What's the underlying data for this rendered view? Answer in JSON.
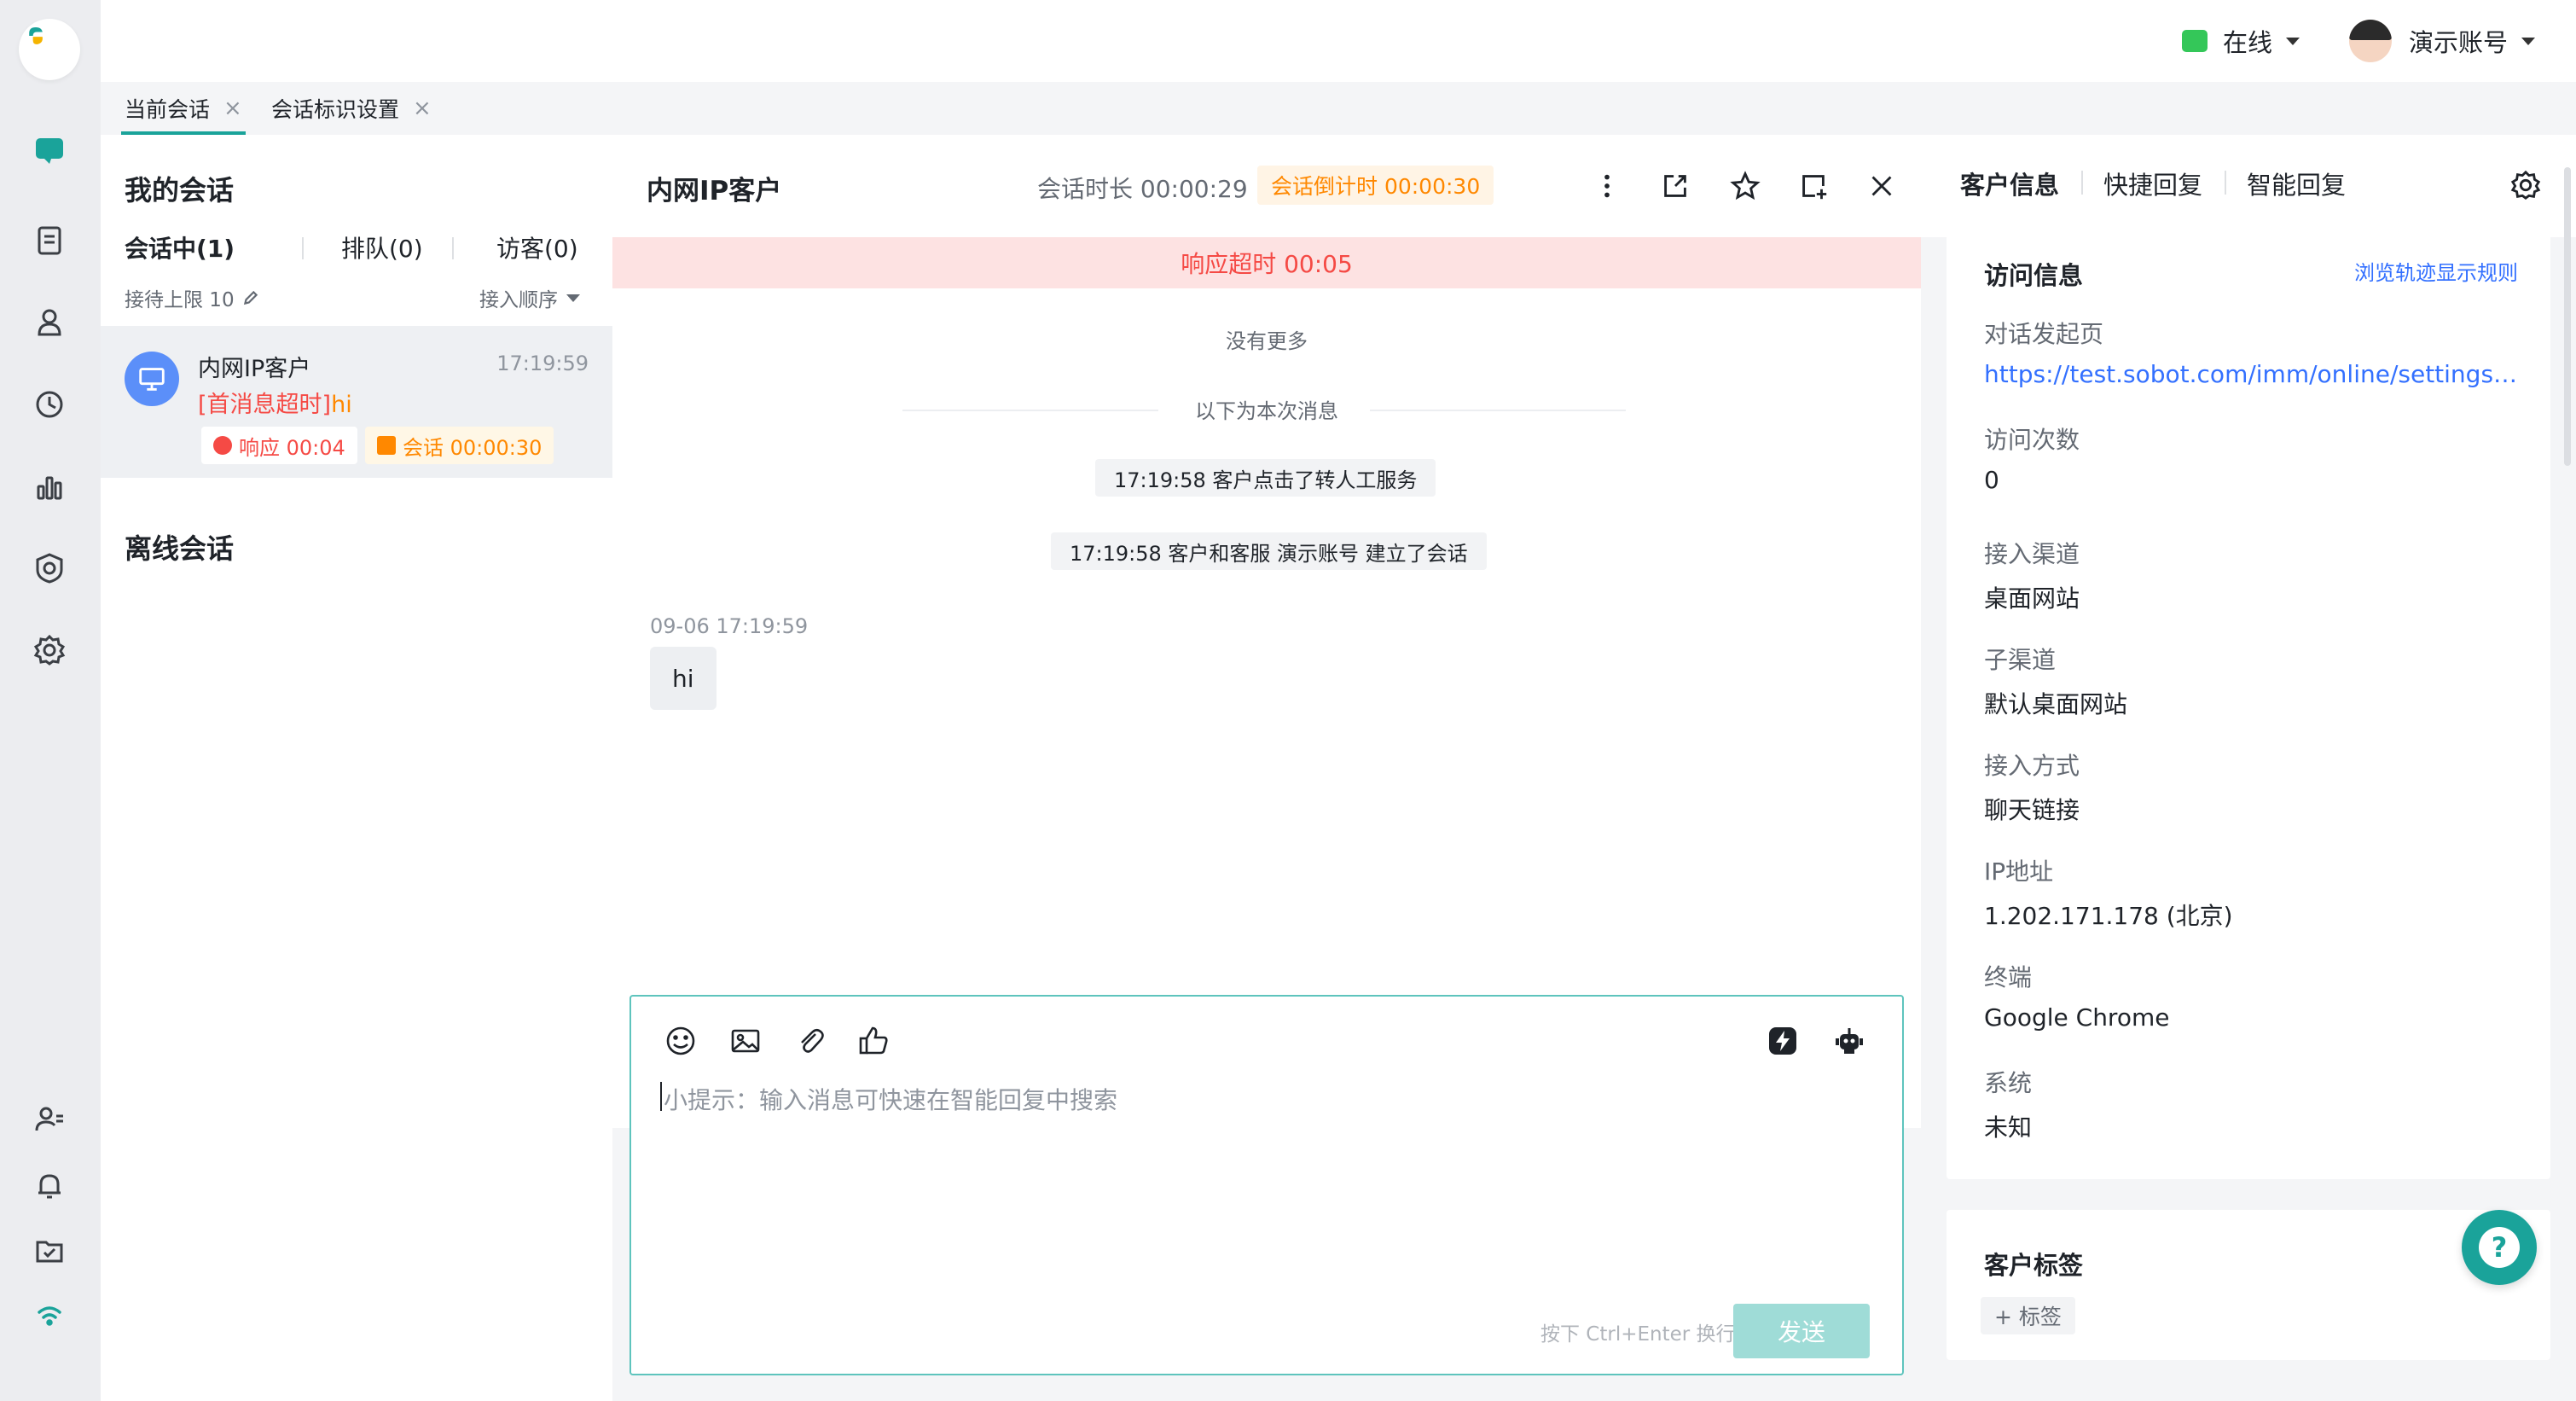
{
  "topbar": {
    "status_label": "在线",
    "user_name": "演示账号"
  },
  "tabs": [
    {
      "label": "当前会话",
      "close": "×"
    },
    {
      "label": "会话标识设置",
      "close": "×"
    }
  ],
  "conversations": {
    "title": "我的会话",
    "subtabs": [
      "会话中(1)",
      "排队(0)",
      "访客(0)"
    ],
    "limit_label": "接待上限 10",
    "sort_label": "接入顺序",
    "item": {
      "name": "内网IP客户",
      "time": "17:19:59",
      "preview_tag": "[首消息超时]",
      "preview_text": "hi",
      "response_badge": "响应 00:04",
      "session_badge": "会话 00:00:30"
    },
    "offline_title": "离线会话"
  },
  "chat": {
    "title": "内网IP客户",
    "duration": "会话时长 00:00:29",
    "countdown": "会话倒计时 00:00:30",
    "alert": "响应超时 00:05",
    "no_more": "没有更多",
    "divider": "以下为本次消息",
    "sys1": "17:19:58 客户点击了转人工服务",
    "sys2": "17:19:58 客户和客服 演示账号 建立了会话",
    "msg_time": "09-06 17:19:59",
    "msg_text": "hi",
    "placeholder": "小提示：输入消息可快速在智能回复中搜索",
    "hint": "按下 Ctrl+Enter 换行",
    "send": "发送"
  },
  "info": {
    "tabs": [
      "客户信息",
      "快捷回复",
      "智能回复"
    ],
    "visit_title": "访问信息",
    "rules_link": "浏览轨迹显示规则",
    "fields": [
      {
        "label": "对话发起页",
        "value": "https://test.sobot.com/imm/online/settings/ses..."
      },
      {
        "label": "访问次数",
        "value": "0"
      },
      {
        "label": "接入渠道",
        "value": "桌面网站"
      },
      {
        "label": "子渠道",
        "value": "默认桌面网站"
      },
      {
        "label": "接入方式",
        "value": "聊天链接"
      },
      {
        "label": "IP地址",
        "value": "1.202.171.178 (北京)"
      },
      {
        "label": "终端",
        "value": "Google Chrome"
      },
      {
        "label": "系统",
        "value": "未知"
      }
    ],
    "tags_title": "客户标签",
    "tag_button": "+ 标签"
  },
  "colors": {
    "accent": "#1aa39a",
    "danger": "#f54a45",
    "warning": "#ff8800",
    "link": "#3370ff"
  }
}
